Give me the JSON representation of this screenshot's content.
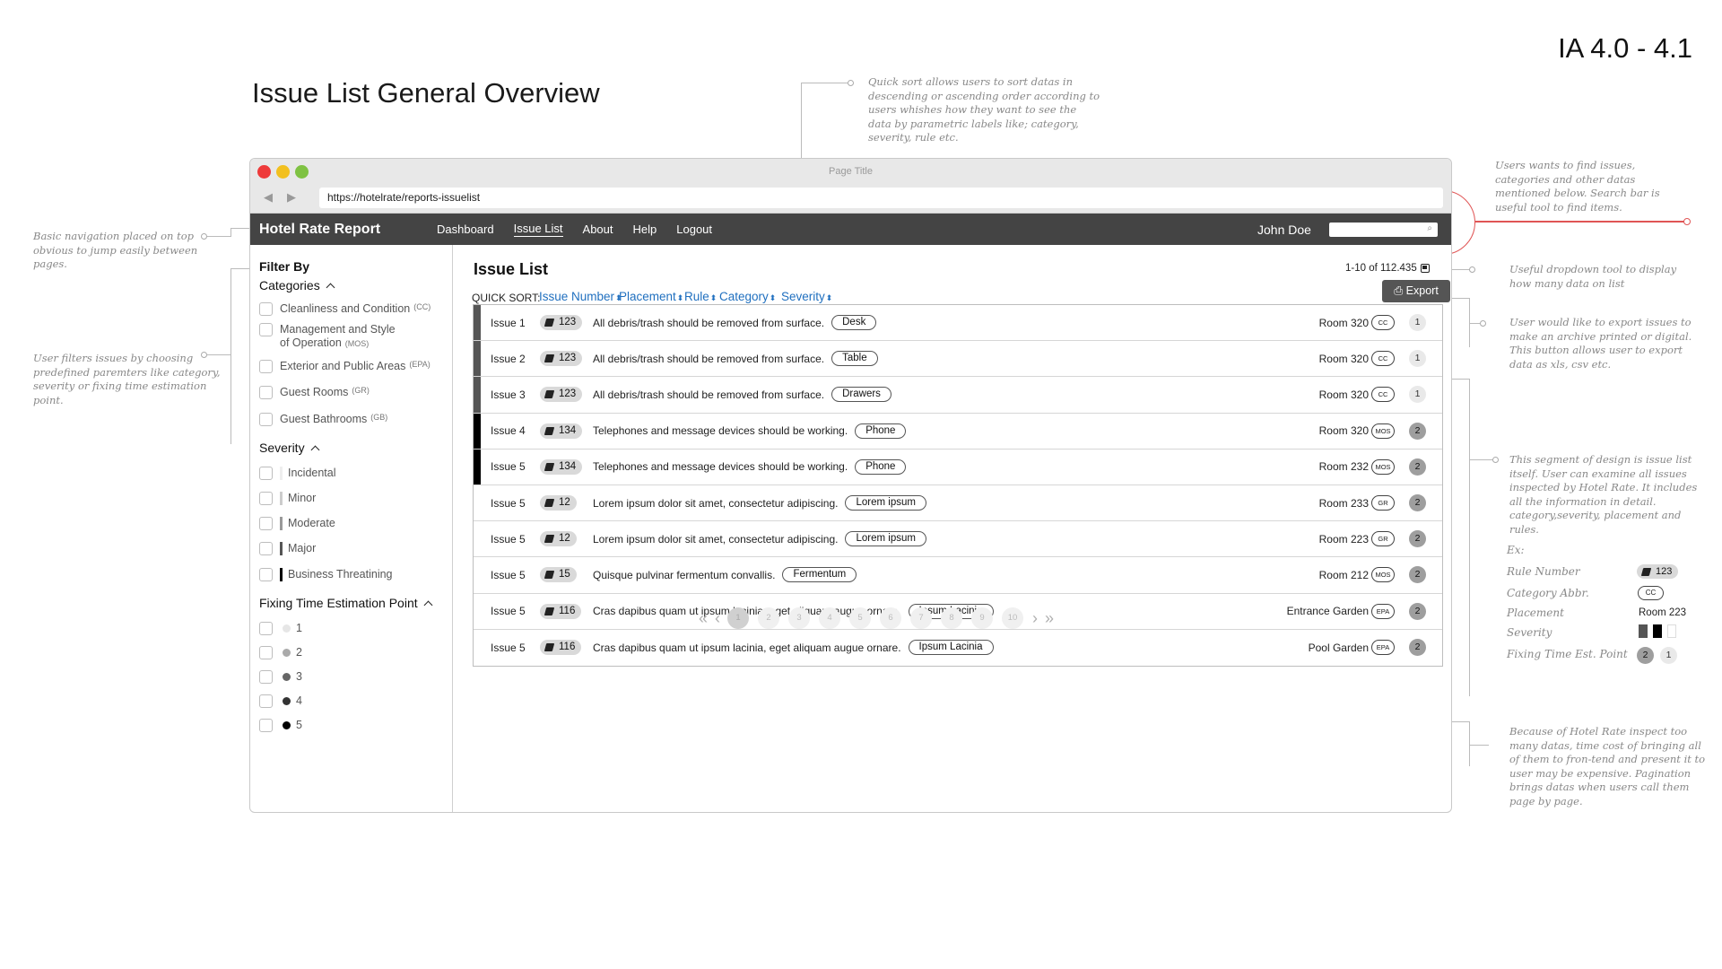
{
  "page": {
    "title": "Issue List General Overview",
    "version": "IA 4.0 - 4.1"
  },
  "browser": {
    "window_title": "Page Title",
    "url": "https://hotelrate/reports-issuelist"
  },
  "navbar": {
    "brand": "Hotel Rate Report",
    "items": [
      {
        "label": "Dashboard",
        "active": false
      },
      {
        "label": "Issue List",
        "active": true
      },
      {
        "label": "About",
        "active": false
      },
      {
        "label": "Help",
        "active": false
      },
      {
        "label": "Logout",
        "active": false
      }
    ],
    "user": "John Doe"
  },
  "sidebar": {
    "title": "Filter By",
    "categories_title": "Categories",
    "categories": [
      {
        "label": "Cleanliness and Condition",
        "abbr": "(CC)"
      },
      {
        "label": "Management and Style",
        "label2": "of Operation",
        "abbr": "(MOS)"
      },
      {
        "label": "Exterior and Public Areas",
        "abbr": "(EPA)"
      },
      {
        "label": "Guest Rooms",
        "abbr": "(GR)"
      },
      {
        "label": "Guest Bathrooms",
        "abbr": "(GB)"
      }
    ],
    "severity_title": "Severity",
    "severity": [
      {
        "label": "Incidental",
        "color": "#eeeeee"
      },
      {
        "label": "Minor",
        "color": "#cccccc"
      },
      {
        "label": "Moderate",
        "color": "#999999"
      },
      {
        "label": "Major",
        "color": "#555555"
      },
      {
        "label": "Business Threatining",
        "color": "#000000"
      }
    ],
    "fixing_title": "Fixing Time Estimation Point",
    "fixing": [
      {
        "label": "1",
        "color": "#e6e6e6"
      },
      {
        "label": "2",
        "color": "#aaaaaa"
      },
      {
        "label": "3",
        "color": "#666666"
      },
      {
        "label": "4",
        "color": "#333333"
      },
      {
        "label": "5",
        "color": "#000000"
      }
    ]
  },
  "main": {
    "title": "Issue List",
    "count": "1-10 of 112.435",
    "quick_sort_label": "QUICK SORT:",
    "sort_links": [
      "Issue Number",
      "Placement",
      "Rule",
      "Category",
      "Severity"
    ],
    "export_label": "Export",
    "rows": [
      {
        "issue": "Issue 1",
        "rule": "123",
        "text": "All debris/trash should be removed from surface.",
        "placement": "Desk",
        "room": "Room 320",
        "cat": "CC",
        "ft": "1",
        "sev": "#555555"
      },
      {
        "issue": "Issue 2",
        "rule": "123",
        "text": "All debris/trash should be removed from surface.",
        "placement": "Table",
        "room": "Room 320",
        "cat": "CC",
        "ft": "1",
        "sev": "#555555"
      },
      {
        "issue": "Issue 3",
        "rule": "123",
        "text": "All debris/trash should be removed from surface.",
        "placement": "Drawers",
        "room": "Room 320",
        "cat": "CC",
        "ft": "1",
        "sev": "#555555"
      },
      {
        "issue": "Issue 4",
        "rule": "134",
        "text": "Telephones and message devices should be working.",
        "placement": "Phone",
        "room": "Room 320",
        "cat": "MOS",
        "ft": "2",
        "sev": "#000000"
      },
      {
        "issue": "Issue 5",
        "rule": "134",
        "text": "Telephones and message devices should be working.",
        "placement": "Phone",
        "room": "Room 232",
        "cat": "MOS",
        "ft": "2",
        "sev": "#000000"
      },
      {
        "issue": "Issue 5",
        "rule": "12",
        "text": "Lorem ipsum dolor sit amet, consectetur adipiscing.",
        "placement": "Lorem ipsum",
        "room": "Room 233",
        "cat": "GR",
        "ft": "2",
        "sev": "#ffffff"
      },
      {
        "issue": "Issue 5",
        "rule": "12",
        "text": "Lorem ipsum dolor sit amet, consectetur adipiscing.",
        "placement": "Lorem ipsum",
        "room": "Room 223",
        "cat": "GR",
        "ft": "2",
        "sev": "#ffffff"
      },
      {
        "issue": "Issue 5",
        "rule": "15",
        "text": "Quisque pulvinar fermentum convallis.",
        "placement": "Fermentum",
        "room": "Room 212",
        "cat": "MOS",
        "ft": "2",
        "sev": "#ffffff"
      },
      {
        "issue": "Issue 5",
        "rule": "116",
        "text": "Cras dapibus quam ut ipsum lacinia, eget aliquam augue ornare.",
        "placement": "Ipsum Lacinia",
        "room": "Entrance Garden",
        "cat": "EPA",
        "ft": "2",
        "sev": "#ffffff"
      },
      {
        "issue": "Issue 5",
        "rule": "116",
        "text": "Cras dapibus quam ut ipsum lacinia, eget aliquam augue ornare.",
        "placement": "Ipsum Lacinia",
        "room": "Pool Garden",
        "cat": "EPA",
        "ft": "2",
        "sev": "#ffffff"
      }
    ],
    "pages": [
      "1",
      "2",
      "3",
      "4",
      "5",
      "6",
      "7",
      "8",
      "9",
      "10"
    ]
  },
  "notes": {
    "nav": "Basic navigation placed on top obvious to jump easily between pages.",
    "filters": "User filters issues by choosing predefined paremters like category, severity or fixing time estimation point.",
    "quicksort": "Quick sort allows users to sort datas in descending or ascending order according to users whishes how they want to see the data by parametric labels like; category, severity, rule etc.",
    "search": "Users wants to find issues, categories and other datas mentioned below. Search bar is useful tool to find items.",
    "dropdown": "Useful dropdown tool to display how many data on list",
    "export": "User would like to export issues to make an archive printed or digital. This button allows user to export data as xls, csv etc.",
    "issue_list": "This segment of design is issue list itself. User can examine all issues inspected by Hotel Rate. It includes all the information in detail. category,severity, placement and rules.",
    "pagination": "Because of Hotel Rate inspect too many datas, time cost of bringing all of them to fron-tend and present it to user may be expensive. Pagination brings datas when users call them page by page."
  },
  "legend": {
    "ex": "Ex:",
    "rule_label": "Rule Number",
    "rule_value": "123",
    "cat_label": "Category Abbr.",
    "cat_value": "CC",
    "place_label": "Placement",
    "place_value": "Room 223",
    "sev_label": "Severity",
    "ft_label": "Fixing Time Est. Point",
    "ft_values": [
      "2",
      "1"
    ]
  }
}
